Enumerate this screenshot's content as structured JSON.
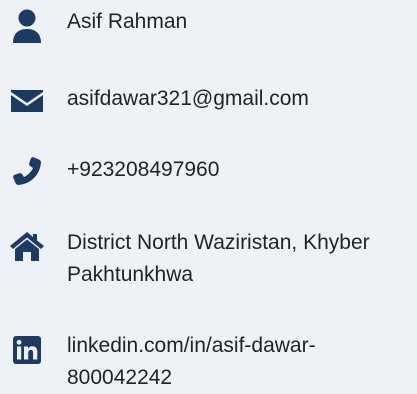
{
  "contact": {
    "name": "Asif Rahman",
    "email": "asifdawar321@gmail.com",
    "phone": "+923208497960",
    "address": "District North Waziristan, Khyber Pakhtunkhwa",
    "linkedin": "linkedin.com/in/asif-dawar-800042242"
  },
  "icons": {
    "name": "user-icon",
    "email": "envelope-icon",
    "phone": "phone-icon",
    "address": "home-icon",
    "linkedin": "linkedin-icon"
  },
  "colors": {
    "background": "#eef1f5",
    "icon": "#1d3a63",
    "text": "#1f2328"
  }
}
